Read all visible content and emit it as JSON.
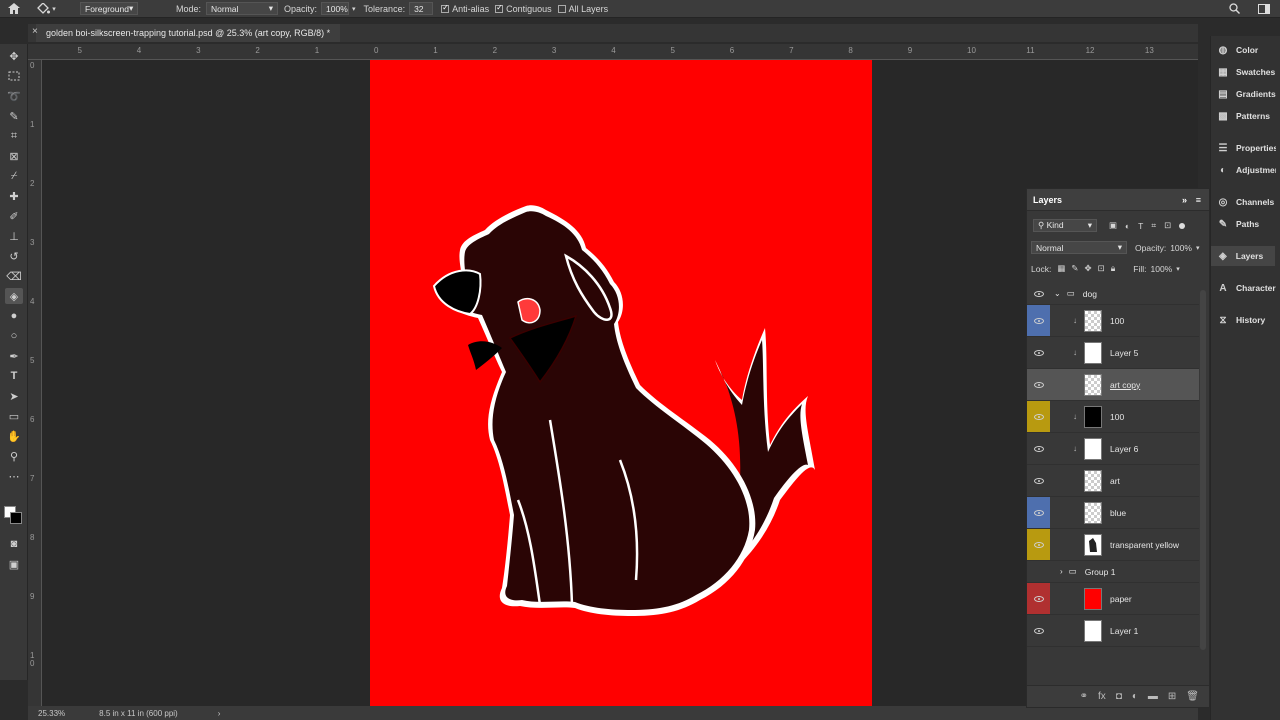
{
  "options": {
    "preset": "Foreground",
    "mode_label": "Mode:",
    "mode_value": "Normal",
    "opacity_label": "Opacity:",
    "opacity_value": "100%",
    "tolerance_label": "Tolerance:",
    "tolerance_value": "32",
    "antialias": "Anti-alias",
    "contiguous": "Contiguous",
    "all_layers": "All Layers"
  },
  "document": {
    "tab_title": "golden boi-silkscreen-trapping tutorial.psd @ 25.3% (art copy, RGB/8) *",
    "close": "×"
  },
  "rulers": {
    "h_ticks": [
      "5",
      "4",
      "3",
      "2",
      "1",
      "0",
      "1",
      "2",
      "3",
      "4",
      "5",
      "6",
      "7",
      "8",
      "9",
      "10",
      "11",
      "12",
      "13"
    ],
    "v_ticks": [
      "0",
      "1",
      "2",
      "3",
      "4",
      "5",
      "6",
      "7",
      "8",
      "9",
      "1\n0"
    ]
  },
  "status": {
    "zoom": "25.33%",
    "doc_size": "8.5 in x 11 in (600 ppi)"
  },
  "right_panels": [
    {
      "label": "Color",
      "icon": "color-icon"
    },
    {
      "label": "Swatches",
      "icon": "swatches-icon"
    },
    {
      "label": "Gradients",
      "icon": "gradients-icon"
    },
    {
      "label": "Patterns",
      "icon": "patterns-icon"
    },
    {
      "label": "Properties",
      "icon": "properties-icon"
    },
    {
      "label": "Adjustments",
      "icon": "adjustments-icon"
    },
    {
      "label": "Channels",
      "icon": "channels-icon"
    },
    {
      "label": "Paths",
      "icon": "paths-icon"
    },
    {
      "label": "Layers",
      "icon": "layers-icon"
    },
    {
      "label": "Character",
      "icon": "character-icon"
    },
    {
      "label": "History",
      "icon": "history-icon"
    }
  ],
  "layers_panel": {
    "title": "Layers",
    "filter": "Kind",
    "blend_mode": "Normal",
    "opacity_label": "Opacity:",
    "opacity_value": "100%",
    "lock_label": "Lock:",
    "fill_label": "Fill:",
    "fill_value": "100%",
    "items": [
      {
        "name": "dog",
        "type": "group",
        "tag": ""
      },
      {
        "name": "100",
        "type": "clip",
        "tag": "#4e6fae",
        "thumb": "check"
      },
      {
        "name": "Layer 5",
        "type": "clip",
        "tag": "",
        "thumb": "white"
      },
      {
        "name": "art copy",
        "type": "layer",
        "tag": "",
        "thumb": "check",
        "selected": true
      },
      {
        "name": "100",
        "type": "clip",
        "tag": "#b89a10",
        "thumb": "black"
      },
      {
        "name": "Layer 6",
        "type": "clip",
        "tag": "",
        "thumb": "white"
      },
      {
        "name": "art",
        "type": "layer",
        "tag": "",
        "thumb": "check"
      },
      {
        "name": "blue",
        "type": "layer",
        "tag": "#4e6fae",
        "thumb": "check"
      },
      {
        "name": "transparent yellow",
        "type": "layer",
        "tag": "#b89a10",
        "thumb": "dog"
      },
      {
        "name": "Group 1",
        "type": "group-collapsed",
        "tag": ""
      },
      {
        "name": "paper",
        "type": "layer",
        "tag": "#b03030",
        "thumb": "red"
      },
      {
        "name": "Layer 1",
        "type": "layer",
        "tag": "",
        "thumb": "white"
      }
    ]
  },
  "colors": {
    "paper": "#ff0000",
    "dog": "#2a0505",
    "outline": "#ffffff"
  }
}
